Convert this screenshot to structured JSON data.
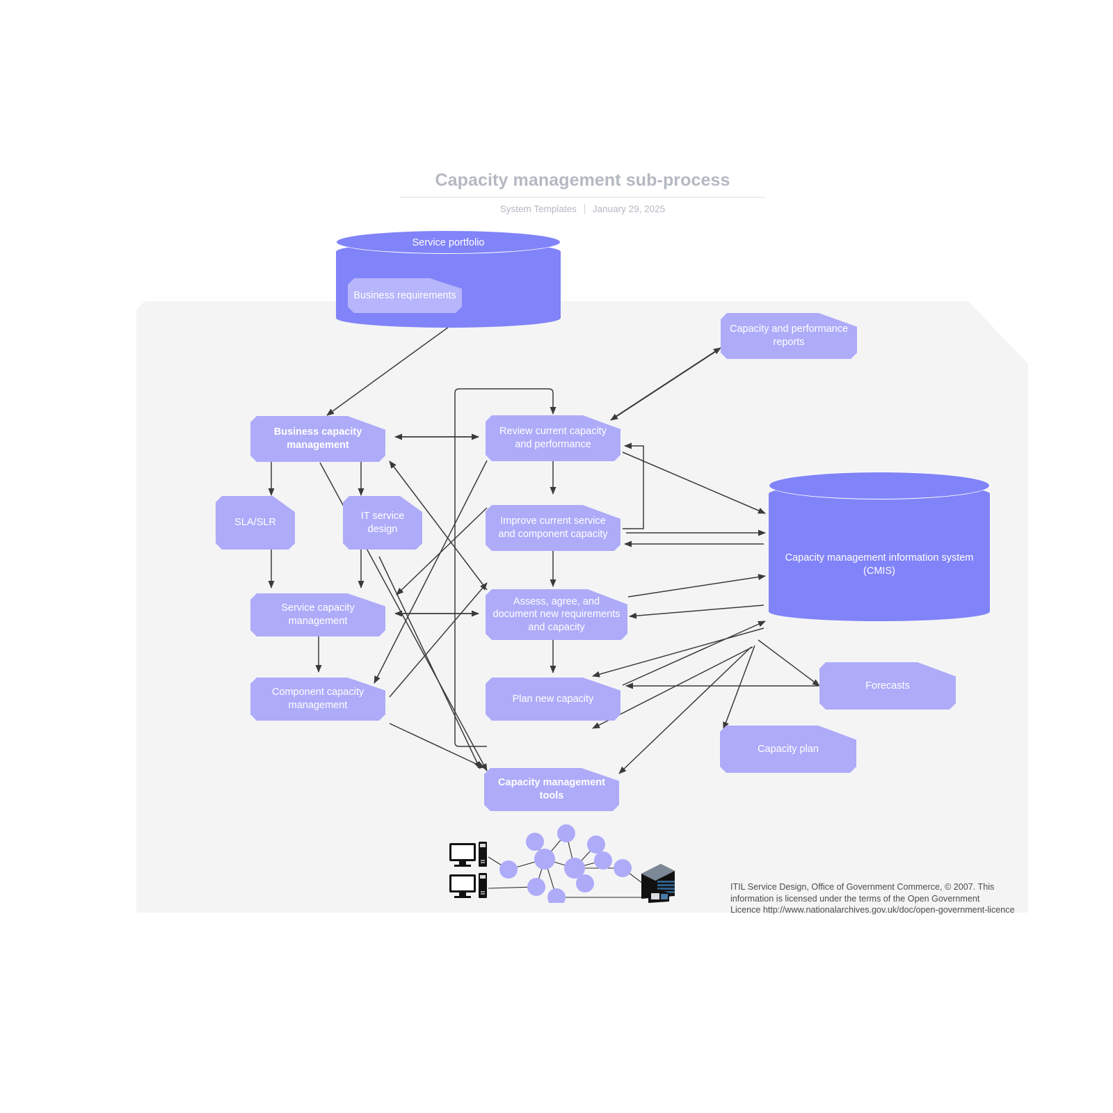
{
  "header": {
    "title": "Capacity management sub-process",
    "source": "System Templates",
    "date": "January 29, 2025",
    "divider": "|"
  },
  "colors": {
    "node_fill": "#aeabf9",
    "cylinder_fill": "#8183f8",
    "nested_doc_fill": "#b7b5fb",
    "panel_bg": "#f4f4f5",
    "node_text": "#ffffff",
    "header_text": "#b4b8c2",
    "connector": "#3a3a3a",
    "credit_text": "#4c4c4c"
  },
  "diagram": {
    "type": "flowchart",
    "stores": [
      {
        "id": "service-portfolio",
        "label": "Service portfolio",
        "shape": "cylinder",
        "contains": "Business requirements"
      },
      {
        "id": "cmis",
        "label": "Capacity management information system (CMIS)",
        "shape": "cylinder"
      }
    ],
    "nested_documents": [
      {
        "id": "business-requirements",
        "label": "Business requirements"
      }
    ],
    "nodes": [
      {
        "id": "business-capacity-management",
        "label": "Business capacity management",
        "bold": true
      },
      {
        "id": "sla-slr",
        "label": "SLA/SLR",
        "bold": false
      },
      {
        "id": "it-service-design",
        "label": "IT service design",
        "bold": false
      },
      {
        "id": "service-capacity-management",
        "label": "Service capacity management",
        "bold": false
      },
      {
        "id": "component-capacity-management",
        "label": "Component capacity management",
        "bold": false
      },
      {
        "id": "review-current-capacity",
        "label": "Review current capacity and performance",
        "bold": false
      },
      {
        "id": "improve-current-service",
        "label": "Improve current service and component capacity",
        "bold": false
      },
      {
        "id": "assess-agree-document",
        "label": "Assess, agree, and document new requirements and capacity",
        "bold": false
      },
      {
        "id": "plan-new-capacity",
        "label": "Plan new capacity",
        "bold": false
      },
      {
        "id": "capacity-management-tools",
        "label": "Capacity management tools",
        "bold": true
      },
      {
        "id": "capacity-performance-reports",
        "label": "Capacity and performance reports",
        "bold": false
      },
      {
        "id": "forecasts",
        "label": "Forecasts",
        "bold": false
      },
      {
        "id": "capacity-plan",
        "label": "Capacity plan",
        "bold": false
      }
    ],
    "edges": [
      {
        "from": "service-portfolio",
        "to": "business-capacity-management",
        "arrow": "single"
      },
      {
        "from": "business-capacity-management",
        "to": "sla-slr",
        "arrow": "single"
      },
      {
        "from": "business-capacity-management",
        "to": "it-service-design",
        "arrow": "single"
      },
      {
        "from": "business-capacity-management",
        "to": "review-current-capacity",
        "arrow": "double"
      },
      {
        "from": "sla-slr",
        "to": "service-capacity-management",
        "arrow": "single"
      },
      {
        "from": "it-service-design",
        "to": "service-capacity-management",
        "arrow": "single"
      },
      {
        "from": "service-capacity-management",
        "to": "component-capacity-management",
        "arrow": "single"
      },
      {
        "from": "service-capacity-management",
        "to": "assess-agree-document",
        "arrow": "double"
      },
      {
        "from": "review-current-capacity",
        "to": "improve-current-service",
        "arrow": "single"
      },
      {
        "from": "review-current-capacity",
        "to": "capacity-performance-reports",
        "arrow": "double"
      },
      {
        "from": "improve-current-service",
        "to": "assess-agree-document",
        "arrow": "single"
      },
      {
        "from": "improve-current-service",
        "to": "review-current-capacity",
        "arrow": "single"
      },
      {
        "from": "assess-agree-document",
        "to": "plan-new-capacity",
        "arrow": "single"
      },
      {
        "from": "review-current-capacity",
        "to": "cmis",
        "arrow": "single"
      },
      {
        "from": "improve-current-service",
        "to": "cmis",
        "arrow": "double"
      },
      {
        "from": "assess-agree-document",
        "to": "cmis",
        "arrow": "double"
      },
      {
        "from": "plan-new-capacity",
        "to": "cmis",
        "arrow": "double"
      },
      {
        "from": "cmis",
        "to": "forecasts",
        "arrow": "double"
      },
      {
        "from": "cmis",
        "to": "capacity-plan",
        "arrow": "single"
      },
      {
        "from": "cmis",
        "to": "capacity-management-tools",
        "arrow": "single"
      },
      {
        "from": "capacity-management-tools",
        "to": "review-current-capacity",
        "arrow": "single"
      },
      {
        "from": "business-capacity-management",
        "to": "capacity-management-tools",
        "arrow": "single"
      },
      {
        "from": "component-capacity-management",
        "to": "capacity-management-tools",
        "arrow": "single"
      },
      {
        "from": "review-current-capacity",
        "to": "component-capacity-management",
        "arrow": "single"
      },
      {
        "from": "assess-agree-document",
        "to": "service-capacity-management",
        "arrow": "single"
      },
      {
        "from": "component-capacity-management",
        "to": "assess-agree-document",
        "arrow": "single"
      }
    ]
  },
  "illustration": {
    "name": "network-diagram",
    "desktops": 2,
    "server_racks": 1,
    "nodes": 11
  },
  "credit": {
    "line1": "ITIL Service Design, Office of Government Commerce, © 2007. This",
    "line2": "information is licensed under the terms of the Open Government",
    "line3": "Licence http://www.nationalarchives.gov.uk/doc/open-government-licence"
  }
}
